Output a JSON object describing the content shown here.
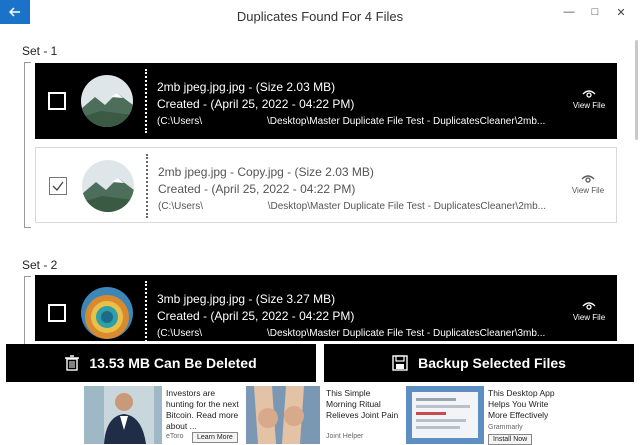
{
  "window": {
    "title": "Duplicates Found For 4 Files"
  },
  "sets": [
    {
      "label": "Set - 1",
      "rows": [
        {
          "name_line": "2mb jpeg.jpg.jpg - (Size 2.03 MB)",
          "created": "Created - (April 25, 2022 - 04:22 PM)",
          "path_start": "(C:\\Users\\",
          "path_end": "\\Desktop\\Master Duplicate File Test - DuplicatesCleaner\\2mb...",
          "view": "View File"
        },
        {
          "name_line": "2mb jpeg.jpg - Copy.jpg - (Size 2.03 MB)",
          "created": "Created - (April 25, 2022 - 04:22 PM)",
          "path_start": "(C:\\Users\\",
          "path_end": "\\Desktop\\Master Duplicate File Test - DuplicatesCleaner\\2mb...",
          "view": "View File"
        }
      ]
    },
    {
      "label": "Set - 2",
      "rows": [
        {
          "name_line": "3mb jpeg.jpg.jpg - (Size 3.27 MB)",
          "created": "Created - (April 25, 2022 - 04:22 PM)",
          "path_start": "(C:\\Users\\",
          "path_end": "\\Desktop\\Master Duplicate File Test - DuplicatesCleaner\\3mb...",
          "view": "View File"
        }
      ]
    }
  ],
  "actions": {
    "delete_label": "13.53 MB Can Be Deleted",
    "backup_label": "Backup Selected Files"
  },
  "ads": [
    {
      "text": "Investors are hunting for the next Bitcoin. Read more about ...",
      "source": "eToro",
      "button": "Learn More"
    },
    {
      "text": "This Simple Morning Ritual Relieves Joint Pain",
      "source": "Joint Helper"
    },
    {
      "text": "This Desktop App Helps You Write More Effectively",
      "source": "Grammarly",
      "button": "Install Now"
    }
  ],
  "colors": {
    "accent": "#1a73c8",
    "dark_row": "#000000"
  }
}
